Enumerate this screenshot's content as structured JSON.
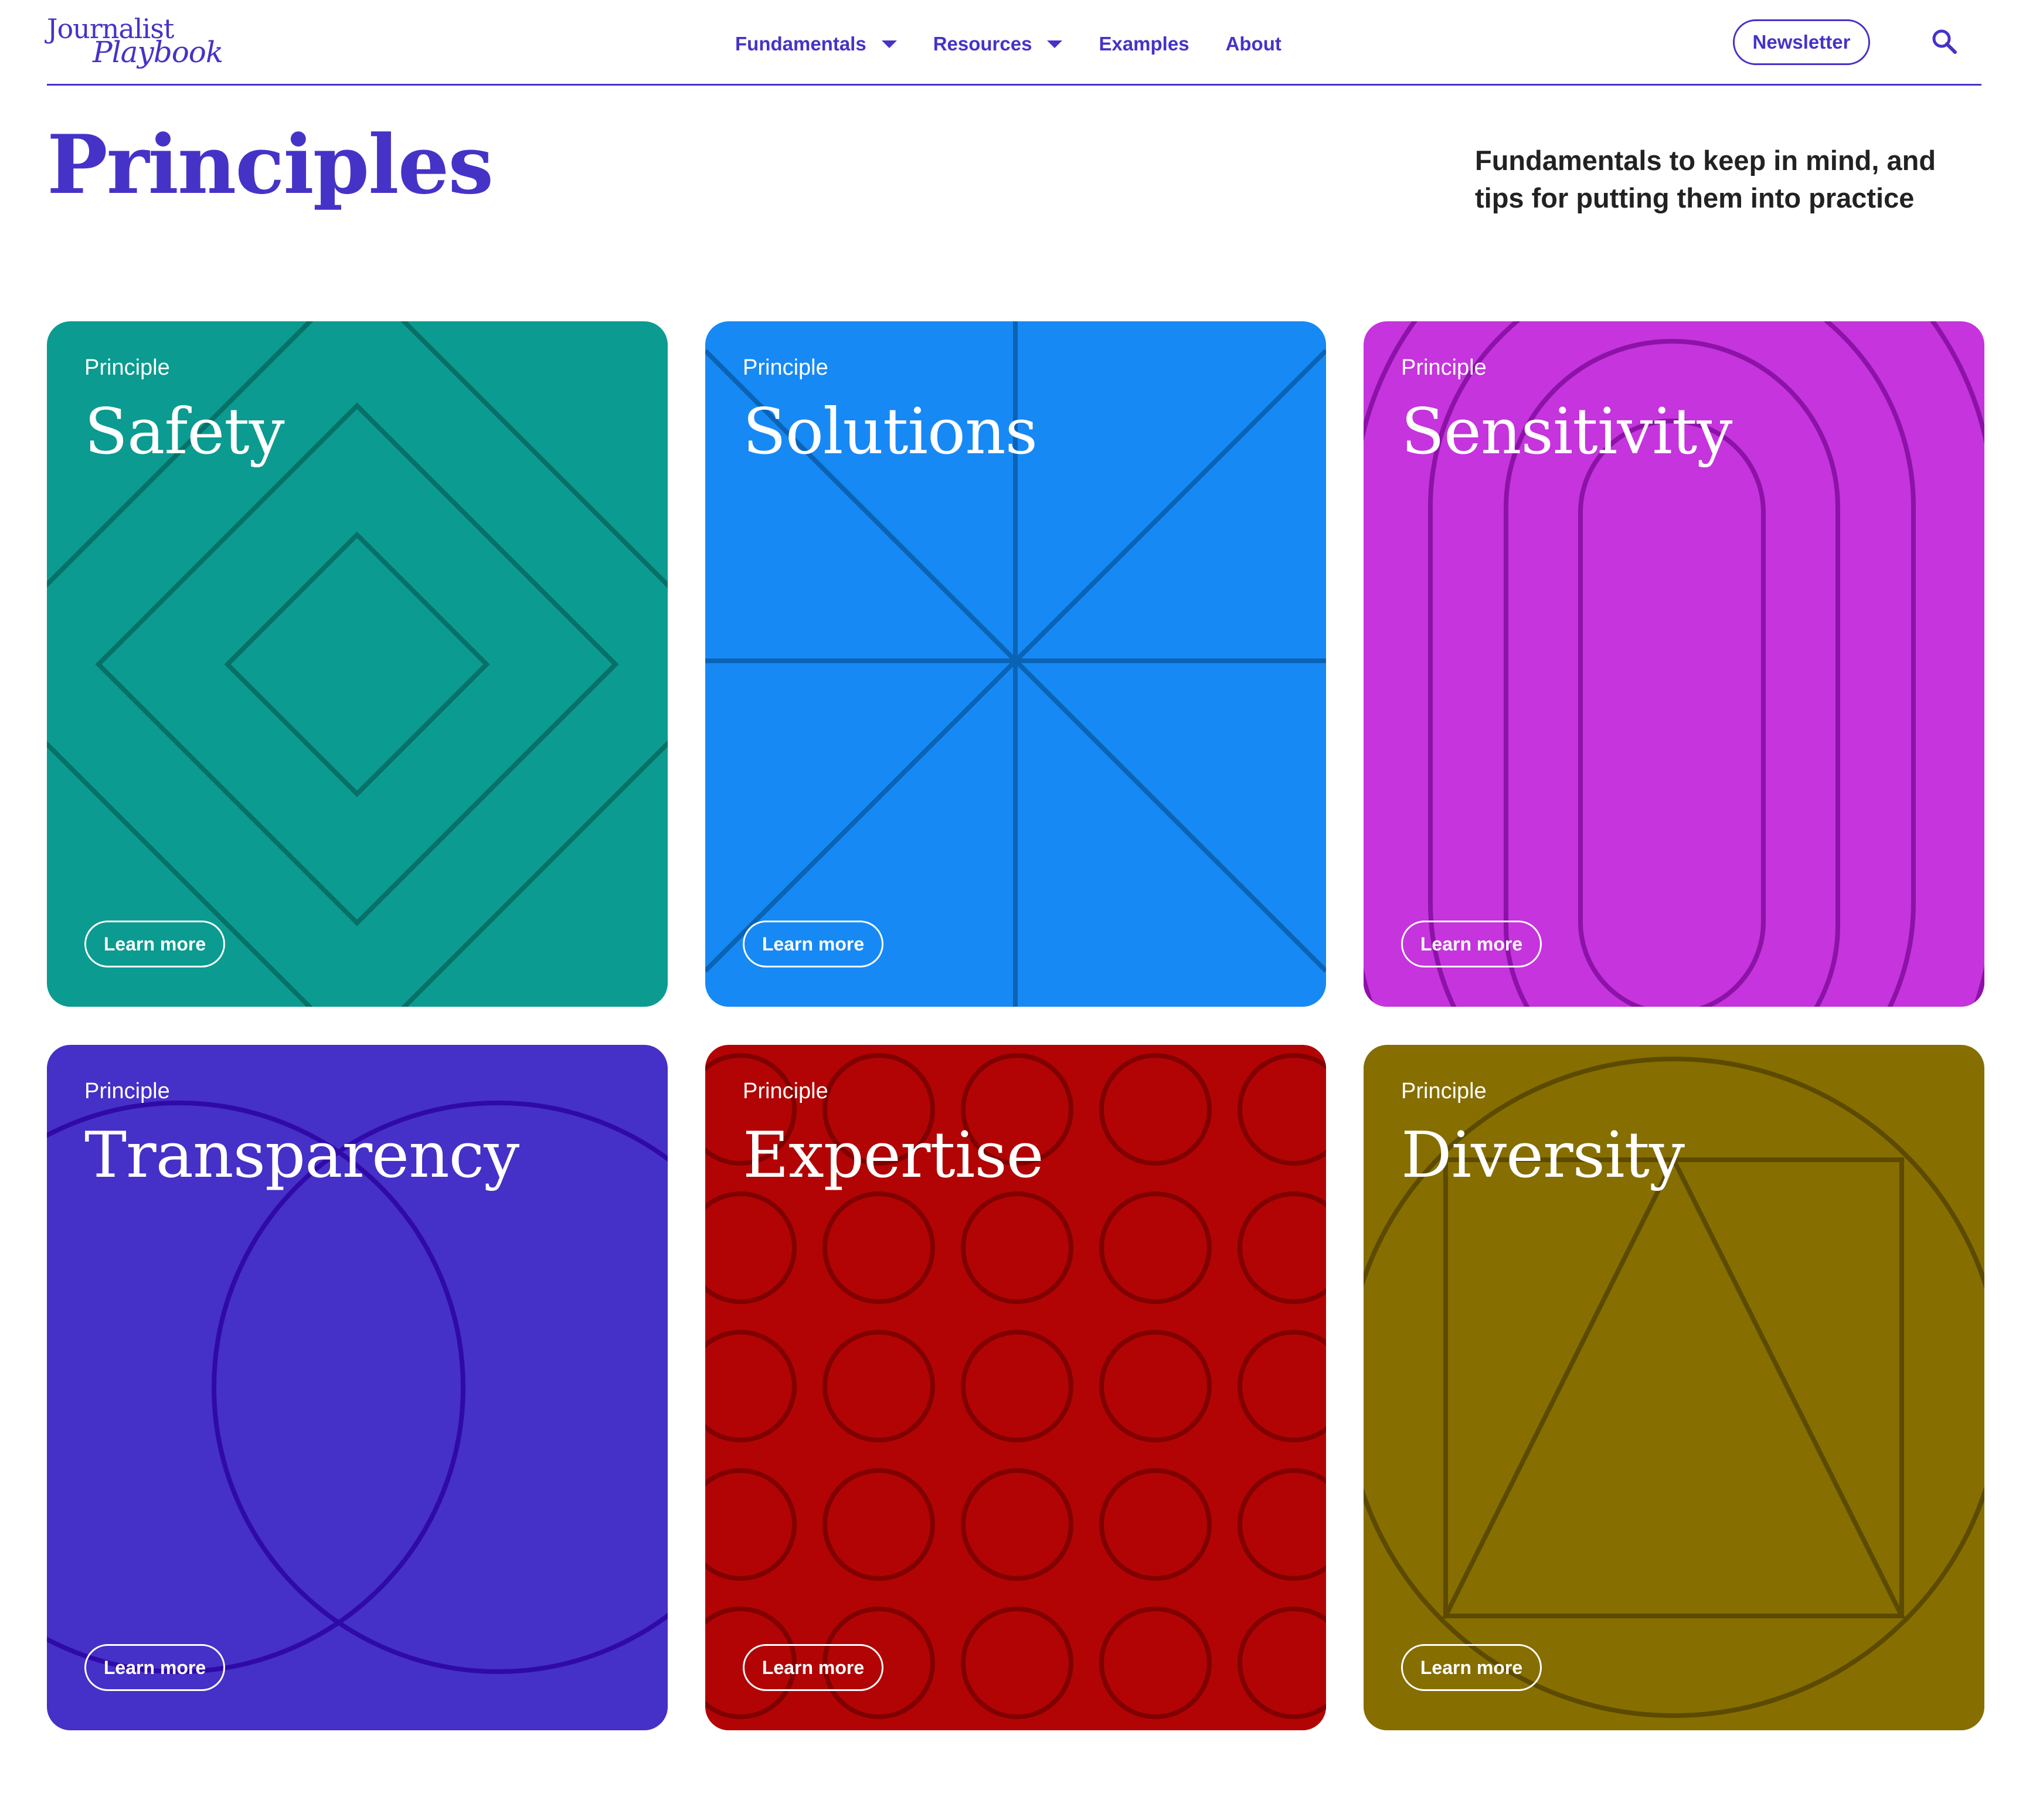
{
  "logo": {
    "line1": "Journalist",
    "line2": "Playbook"
  },
  "nav": {
    "items": [
      {
        "label": "Fundamentals"
      },
      {
        "label": "Resources"
      },
      {
        "label": "Examples"
      },
      {
        "label": "About"
      }
    ],
    "newsletter_label": "Newsletter",
    "search_icon": "search-icon"
  },
  "page": {
    "title": "Principles",
    "subtitle": "Fundamentals to keep in mind, and tips for putting them into practice"
  },
  "cards": [
    {
      "eyebrow": "Principle",
      "title": "Safety",
      "cta": "Learn more",
      "bg": "#0c9b90",
      "line": "#077067"
    },
    {
      "eyebrow": "Principle",
      "title": "Solutions",
      "cta": "Learn more",
      "bg": "#1789f5",
      "line": "#0a63b4"
    },
    {
      "eyebrow": "Principle",
      "title": "Sensitivity",
      "cta": "Learn more",
      "bg": "#c534dc",
      "line": "#8c12a8"
    },
    {
      "eyebrow": "Principle",
      "title": "Transparency",
      "cta": "Learn more",
      "bg": "#4530c8",
      "line": "#300aa8"
    },
    {
      "eyebrow": "Principle",
      "title": "Expertise",
      "cta": "Learn more",
      "bg": "#b20404",
      "line": "#800000"
    },
    {
      "eyebrow": "Principle",
      "title": "Diversity",
      "cta": "Learn more",
      "bg": "#866e00",
      "line": "#5c4a00"
    }
  ]
}
